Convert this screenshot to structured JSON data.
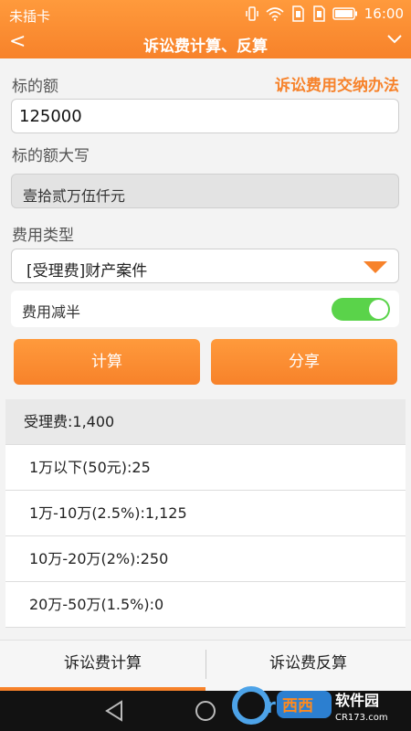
{
  "status": {
    "carrier": "未插卡",
    "time": "16:00"
  },
  "header": {
    "title": "诉讼费计算、反算"
  },
  "form": {
    "amount_label": "标的额",
    "fee_rule_link": "诉讼费用交纳办法",
    "amount_value": "125000",
    "uppercase_label": "标的额大写",
    "uppercase_value": "壹拾贰万伍仟元",
    "fee_type_label": "费用类型",
    "fee_type_value": "[受理费]财产案件",
    "half_label": "费用减半",
    "half_enabled": true
  },
  "buttons": {
    "calculate": "计算",
    "share": "分享"
  },
  "results": {
    "total": "受理费:1,400",
    "rows": [
      "1万以下(50元):25",
      "1万-10万(2.5%):1,125",
      "10万-20万(2%):250",
      "20万-50万(1.5%):0"
    ]
  },
  "tabs": [
    {
      "label": "诉讼费计算",
      "active": true
    },
    {
      "label": "诉讼费反算",
      "active": false
    }
  ],
  "watermark": {
    "text": "西西软件园",
    "domain": "CR173.com"
  },
  "colors": {
    "accent": "#f7822a",
    "toggle_on": "#5ad34a"
  }
}
